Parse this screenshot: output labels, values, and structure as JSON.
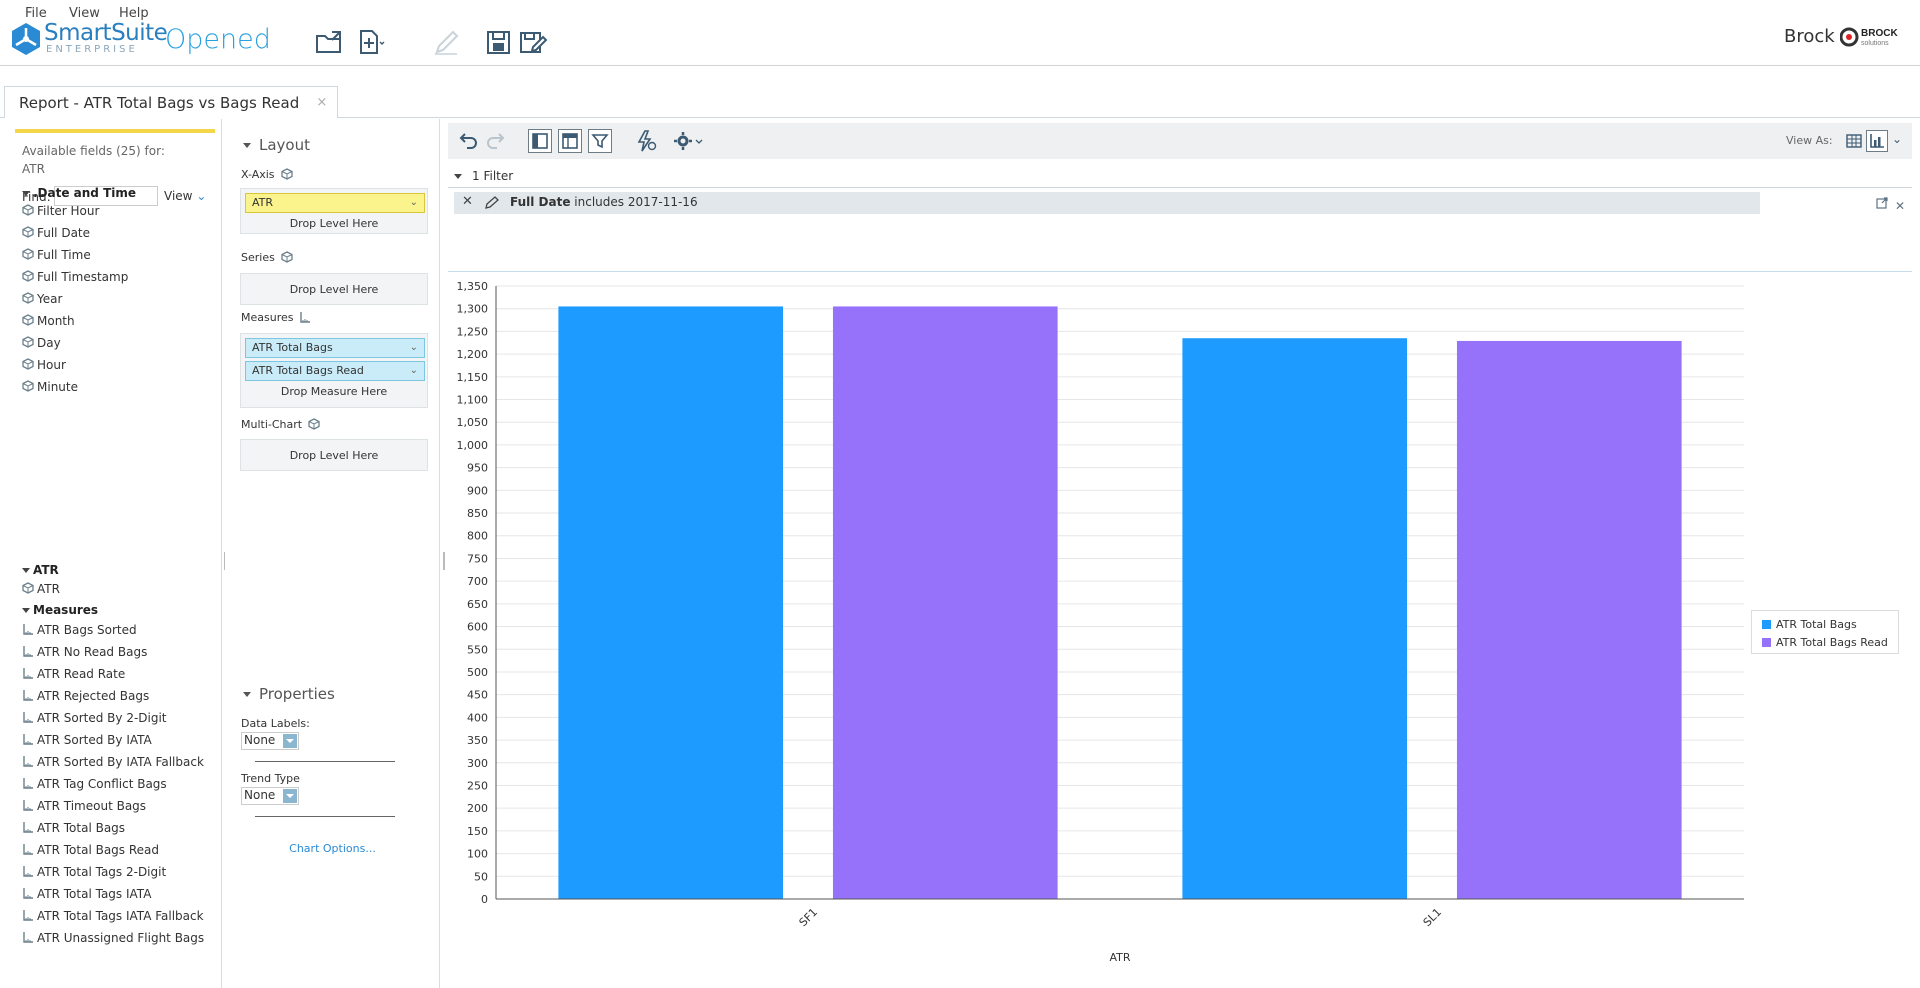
{
  "menu": {
    "file": "File",
    "view": "View",
    "help": "Help"
  },
  "brand": {
    "name": "SmartSuite",
    "edition": "ENTERPRISE",
    "primary_color": "#2a7fbf"
  },
  "status": "Opened",
  "user": {
    "name": "Brock",
    "company_logo_text": "BROCK",
    "company_logo_sub": "solutions"
  },
  "tab": {
    "label": "Report - ATR Total Bags vs Bags Read",
    "close": "×"
  },
  "fields_panel": {
    "available_label": "Available fields (25) for:",
    "available_subject": "ATR",
    "find_label": "Find:",
    "find_value": "",
    "view_label": "View",
    "groups": {
      "date": ".Date and Time",
      "atr": "ATR",
      "measures": "Measures"
    },
    "date_items": [
      "Filter Hour",
      "Full Date",
      "Full Time",
      "Full Timestamp",
      "Year",
      "Month",
      "Day",
      "Hour",
      "Minute"
    ],
    "atr_items": [
      "ATR"
    ],
    "measure_items": [
      "ATR Bags Sorted",
      "ATR No Read Bags",
      "ATR Read Rate",
      "ATR Rejected Bags",
      "ATR Sorted By 2-Digit",
      "ATR Sorted By IATA",
      "ATR Sorted By IATA Fallback",
      "ATR Tag Conflict Bags",
      "ATR Timeout Bags",
      "ATR Total Bags",
      "ATR Total Bags Read",
      "ATR Total Tags 2-Digit",
      "ATR Total Tags IATA",
      "ATR Total Tags IATA Fallback",
      "ATR Unassigned Flight Bags"
    ]
  },
  "layout_panel": {
    "title": "Layout",
    "x_axis_label": "X-Axis",
    "x_axis_chip": "ATR",
    "drop_level": "Drop Level Here",
    "series_label": "Series",
    "measures_label": "Measures",
    "measure_chip_1": "ATR Total Bags",
    "measure_chip_2": "ATR Total Bags Read",
    "drop_measure": "Drop Measure Here",
    "multichart_label": "Multi-Chart",
    "properties_title": "Properties",
    "data_labels_label": "Data Labels:",
    "data_labels_value": "None",
    "trend_type_label": "Trend Type",
    "trend_type_value": "None",
    "chart_options": "Chart Options..."
  },
  "toolbar": {
    "view_as": "View As:"
  },
  "filter": {
    "count_label": "1 Filter",
    "field": "Full Date",
    "condition": " includes 2017-11-16"
  },
  "chart_data": {
    "type": "bar",
    "categories": [
      "SF1",
      "SL1"
    ],
    "series": [
      {
        "name": "ATR Total Bags",
        "values": [
          1305,
          1235
        ],
        "color": "#1e9bff"
      },
      {
        "name": "ATR Total Bags Read",
        "values": [
          1305,
          1229
        ],
        "color": "#9672fb"
      }
    ],
    "xlabel": "ATR",
    "ylabel": "",
    "ylim": [
      0,
      1350
    ],
    "ytick_step": 50,
    "grid": true,
    "legend_position": "right"
  }
}
